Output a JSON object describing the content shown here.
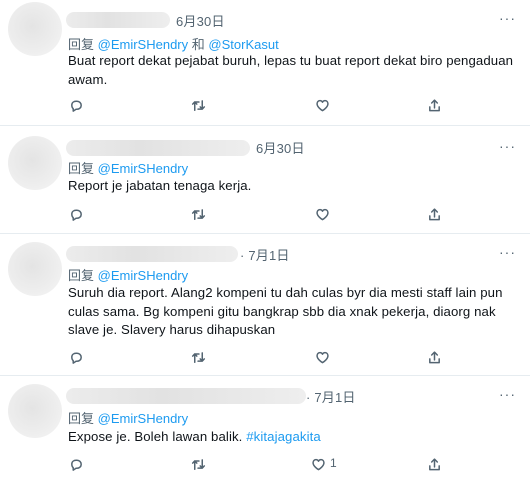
{
  "tweets": [
    {
      "date": "6月30日",
      "reply_prefix": "回复",
      "mention_1": "@EmirSHendry",
      "reply_joiner": "和",
      "mention_2": "@StorKasut",
      "text": "Buat report dekat pejabat buruh, lepas tu buat report dekat biro pengaduan awam.",
      "like_count": ""
    },
    {
      "date": "6月30日",
      "reply_prefix": "回复",
      "mention_1": "@EmirSHendry",
      "text": "Report je jabatan tenaga kerja.",
      "like_count": ""
    },
    {
      "date": "7月1日",
      "reply_prefix": "回复",
      "mention_1": "@EmirSHendry",
      "text": "Suruh dia report. Alang2 kompeni tu dah culas byr dia mesti staff lain pun culas sama. Bg kompeni gitu bangkrap sbb dia xnak pekerja, diaorg nak slave je. Slavery harus dihapuskan",
      "like_count": ""
    },
    {
      "date": "7月1日",
      "reply_prefix": "回复",
      "mention_1": "@EmirSHendry",
      "text": "Expose je. Boleh lawan balik.",
      "hashtag": "#kitajagakita",
      "like_count": "1"
    }
  ],
  "icons": {
    "reply": "reply-icon",
    "retweet": "retweet-icon",
    "like": "like-icon",
    "share": "share-icon",
    "more": "more-icon"
  },
  "colors": {
    "accent": "#1d9bf0",
    "secondary_text": "#536471",
    "divider": "#e6ecf0"
  }
}
